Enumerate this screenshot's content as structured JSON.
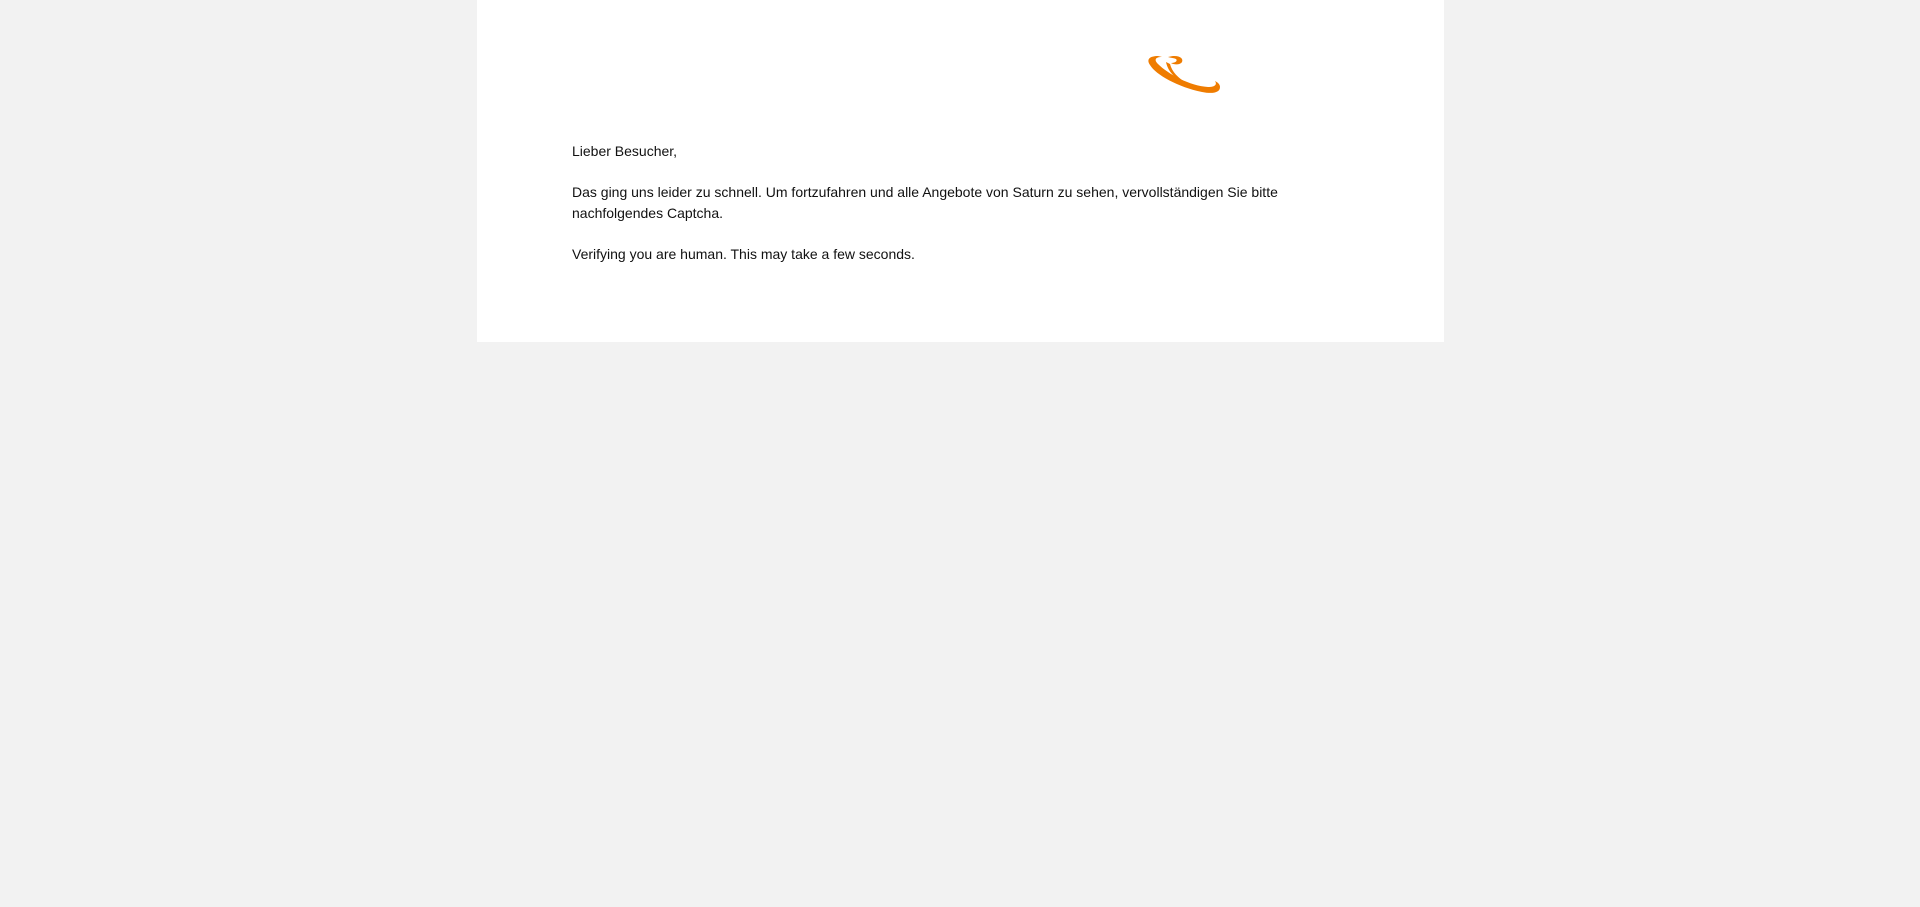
{
  "brand": {
    "logo_icon": "saturn-logo-icon",
    "accent_color": "#ef7c00"
  },
  "message": {
    "greeting": "Lieber Besucher,",
    "body": "Das ging uns leider zu schnell. Um fortzufahren und alle Angebote von Saturn zu sehen, vervollständigen Sie bitte nachfolgendes Captcha.",
    "status": "Verifying you are human. This may take a few seconds."
  }
}
